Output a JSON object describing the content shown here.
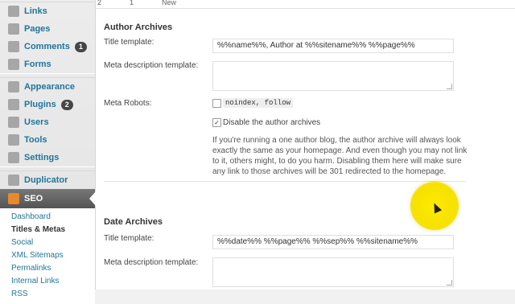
{
  "sidebar": {
    "items": [
      {
        "label": "Links",
        "icon": "link-icon"
      },
      {
        "label": "Pages",
        "icon": "pages-icon"
      },
      {
        "label": "Comments",
        "icon": "comments-icon",
        "badge": "1"
      },
      {
        "label": "Forms",
        "icon": "forms-icon"
      },
      {
        "label": "Appearance",
        "icon": "appearance-icon"
      },
      {
        "label": "Plugins",
        "icon": "plugins-icon",
        "badge": "2"
      },
      {
        "label": "Users",
        "icon": "users-icon"
      },
      {
        "label": "Tools",
        "icon": "tools-icon"
      },
      {
        "label": "Settings",
        "icon": "settings-icon"
      },
      {
        "label": "Duplicator",
        "icon": "duplicator-icon"
      },
      {
        "label": "SEO",
        "icon": "seo-icon"
      }
    ],
    "seo_submenu": [
      "Dashboard",
      "Titles & Metas",
      "Social",
      "XML Sitemaps",
      "Permalinks",
      "Internal Links",
      "RSS"
    ]
  },
  "topstrip": {
    "col1": "2",
    "col2": "1",
    "col3": "New"
  },
  "author": {
    "heading": "Author Archives",
    "title_label": "Title template:",
    "title_value": "%%name%%, Author at %%sitename%% %%page%%",
    "meta_label": "Meta description template:",
    "robots_label": "Meta Robots:",
    "robots_option": "noindex, follow",
    "disable_label": "Disable the author archives",
    "description": "If you're running a one author blog, the author archive will always look exactly the same as your homepage. And even though you may not link to it, others might, to do you harm. Disabling them here will make sure any link to those archives will be 301 redirected to the homepage."
  },
  "date": {
    "heading": "Date Archives",
    "title_label": "Title template:",
    "title_value": "%%date%% %%page%% %%sep%% %%sitename%%",
    "meta_label": "Meta description template:"
  },
  "colors": {
    "accent": "#21759b",
    "highlight": "#ffea00"
  }
}
